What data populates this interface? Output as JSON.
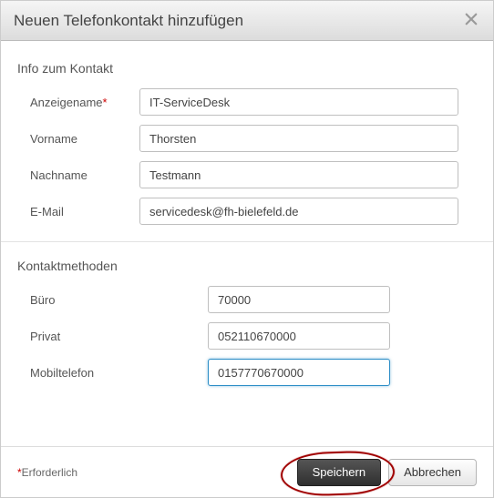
{
  "dialogTitle": "Neuen Telefonkontakt hinzufügen",
  "section1Title": "Info zum Kontakt",
  "section2Title": "Kontaktmethoden",
  "fields": {
    "displayName": {
      "label": "Anzeigename",
      "required": true,
      "value": "IT-ServiceDesk"
    },
    "firstName": {
      "label": "Vorname",
      "value": "Thorsten"
    },
    "lastName": {
      "label": "Nachname",
      "value": "Testmann"
    },
    "email": {
      "label": "E-Mail",
      "value": "servicedesk@fh-bielefeld.de"
    },
    "office": {
      "label": "Büro",
      "value": "70000"
    },
    "private": {
      "label": "Privat",
      "value": "052110670000"
    },
    "mobile": {
      "label": "Mobiltelefon",
      "value": "0157770670000"
    }
  },
  "requiredNote": "Erforderlich",
  "buttons": {
    "save": "Speichern",
    "cancel": "Abbrechen"
  }
}
